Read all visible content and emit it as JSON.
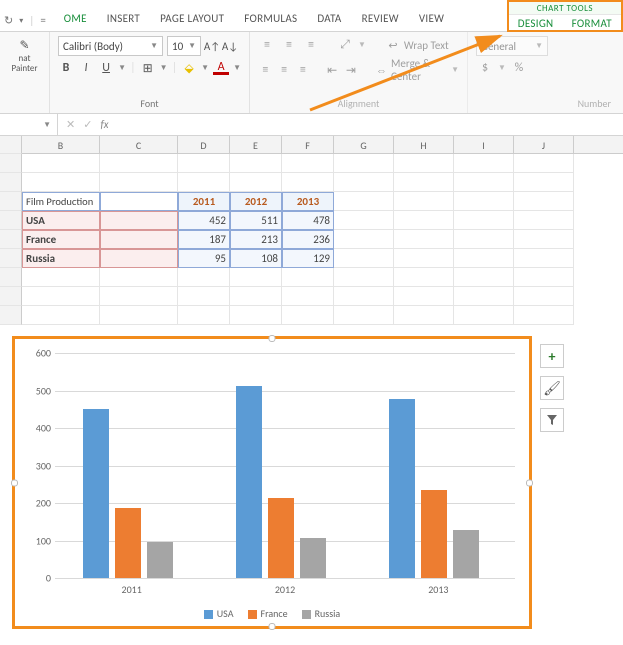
{
  "qat": {
    "redo": "↻",
    "menu": "▾",
    "sep": "="
  },
  "tabs": [
    "OME",
    "INSERT",
    "PAGE LAYOUT",
    "FORMULAS",
    "DATA",
    "REVIEW",
    "VIEW"
  ],
  "chart_tools": {
    "title": "CHART TOOLS",
    "tabs": [
      "DESIGN",
      "FORMAT"
    ]
  },
  "ribbon": {
    "clipboard": {
      "label": "nat Painter"
    },
    "font": {
      "name": "Calibri (Body)",
      "size": "10",
      "bold": "B",
      "italic": "I",
      "underline": "U",
      "group_label": "Font"
    },
    "align": {
      "wrap": "Wrap Text",
      "merge": "Merge & Center",
      "group_label": "Alignment"
    },
    "number": {
      "format": "General",
      "currency": "$",
      "percent": "%",
      "group_label": "Number"
    }
  },
  "fbar": {
    "cancel": "✕",
    "enter": "✓",
    "fx": "fx"
  },
  "cols": [
    "B",
    "C",
    "D",
    "E",
    "F",
    "G",
    "H",
    "I",
    "J"
  ],
  "table": {
    "corner": "Film Production",
    "years": [
      "2011",
      "2012",
      "2013"
    ],
    "rows": [
      {
        "name": "USA",
        "v": [
          452,
          511,
          478
        ]
      },
      {
        "name": "France",
        "v": [
          187,
          213,
          236
        ]
      },
      {
        "name": "Russia",
        "v": [
          95,
          108,
          129
        ]
      }
    ]
  },
  "chart_data": {
    "type": "bar",
    "categories": [
      "2011",
      "2012",
      "2013"
    ],
    "series": [
      {
        "name": "USA",
        "values": [
          452,
          511,
          478
        ],
        "color": "#5b9bd5"
      },
      {
        "name": "France",
        "values": [
          187,
          213,
          236
        ],
        "color": "#ed7d31"
      },
      {
        "name": "Russia",
        "values": [
          95,
          108,
          129
        ],
        "color": "#a5a5a5"
      }
    ],
    "ylim": [
      0,
      600
    ],
    "yticks": [
      0,
      100,
      200,
      300,
      400,
      500,
      600
    ]
  },
  "side": {
    "plus": "+",
    "brush": "🖌",
    "filter": "▼"
  }
}
